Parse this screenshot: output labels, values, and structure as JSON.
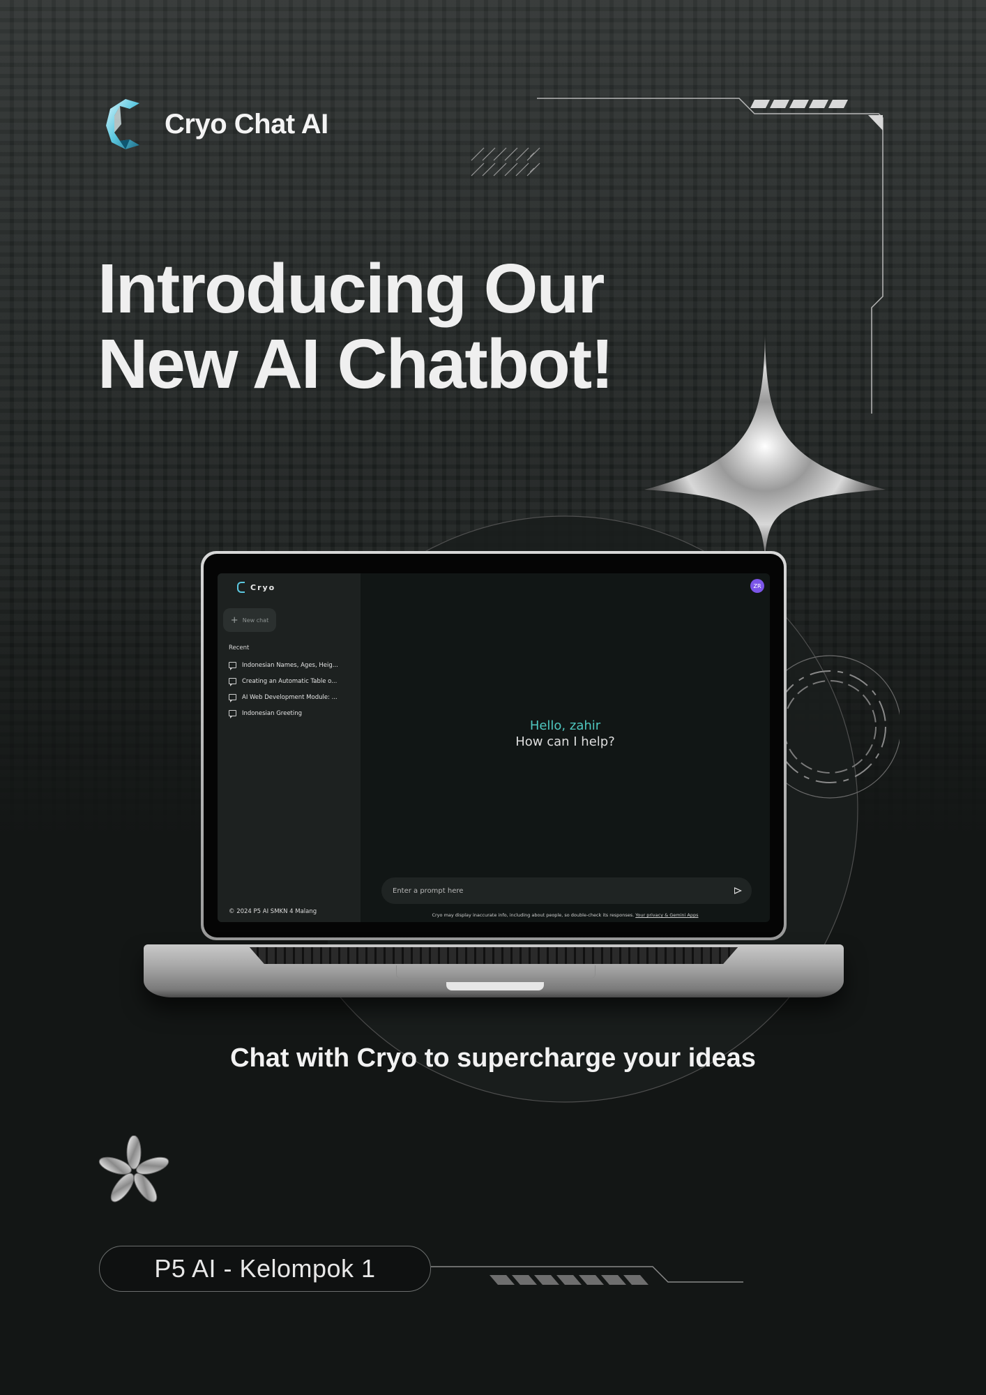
{
  "brand": {
    "name": "Cryo Chat AI",
    "logo_icon": "cryo-c-logo-icon",
    "accent": "#5cc8e0"
  },
  "hero": {
    "line1": "Introducing Our",
    "line2": "New AI Chatbot!"
  },
  "app": {
    "logo_text": "Cryo",
    "new_chat_label": "New chat",
    "recent_title": "Recent",
    "recent_items": [
      "Indonesian Names, Ages, Heig...",
      "Creating an Automatic Table o...",
      "AI Web Development Module: ...",
      "Indonesian Greeting"
    ],
    "footer": "© 2024 P5 AI SMKN 4 Malang",
    "avatar_initials": "ZR",
    "avatar_color": "#7b55e8",
    "greeting_hello": "Hello, zahir",
    "greeting_help": "How can I help?",
    "greeting_color": "#4fc7c0",
    "prompt_placeholder": "Enter a prompt here",
    "disclaimer": "Cryo may display inaccurate info, including about people, so double-check its responses.",
    "disclaimer_link": "Your privacy & Gemini Apps"
  },
  "tagline": "Chat with Cryo to supercharge your ideas",
  "footer_label": "P5 AI - Kelompok 1"
}
